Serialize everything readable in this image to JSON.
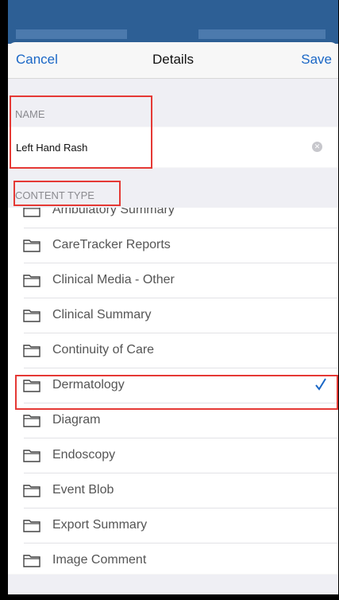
{
  "nav": {
    "cancel_label": "Cancel",
    "title": "Details",
    "save_label": "Save"
  },
  "name_section": {
    "header": "NAME",
    "value": "Left Hand Rash"
  },
  "content_type_section": {
    "header": "CONTENT TYPE"
  },
  "content_types": [
    {
      "label": "Ambulatory Summary",
      "selected": false
    },
    {
      "label": "CareTracker Reports",
      "selected": false
    },
    {
      "label": "Clinical Media  - Other",
      "selected": false
    },
    {
      "label": "Clinical Summary",
      "selected": false
    },
    {
      "label": "Continuity of Care",
      "selected": false
    },
    {
      "label": "Dermatology",
      "selected": true
    },
    {
      "label": "Diagram",
      "selected": false
    },
    {
      "label": "Endoscopy",
      "selected": false
    },
    {
      "label": "Event Blob",
      "selected": false
    },
    {
      "label": "Export Summary",
      "selected": false
    },
    {
      "label": "Image Comment",
      "selected": false
    }
  ],
  "colors": {
    "accent": "#1a67c6",
    "highlight": "#e53935",
    "status_bar": "#2d5f95"
  },
  "icons": {
    "folder": "folder-icon",
    "check": "checkmark-icon",
    "clear": "clear-text-icon"
  }
}
